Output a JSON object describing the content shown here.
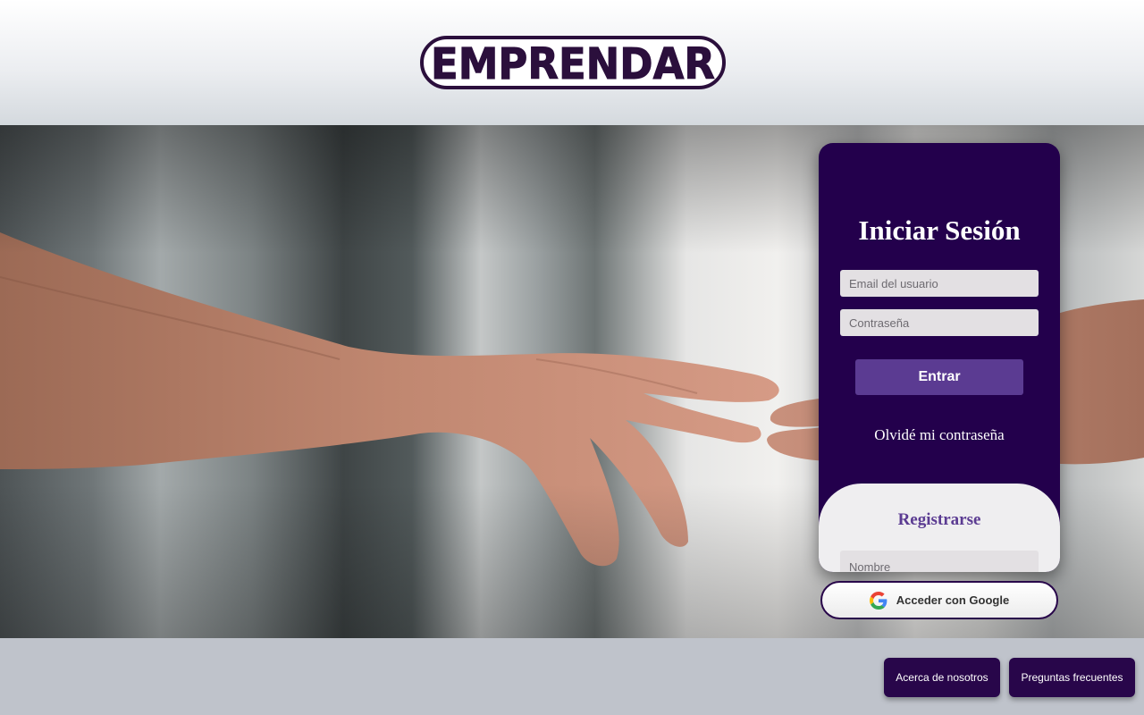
{
  "header": {
    "logo_text": "EMPRENDAR"
  },
  "login": {
    "title": "Iniciar Sesión",
    "email_placeholder": "Email del usuario",
    "password_placeholder": "Contraseña",
    "submit_label": "Entrar",
    "forgot_label": "Olvidé mi contraseña"
  },
  "register": {
    "title": "Registrarse",
    "name_placeholder": "Nombre"
  },
  "google": {
    "label": "Acceder con Google",
    "icon": "google-icon"
  },
  "footer": {
    "about_label": "Acerca de nosotros",
    "faq_label": "Preguntas frecuentes"
  },
  "colors": {
    "brand_purple": "#23004c",
    "accent_purple": "#5b3b92",
    "footer_bg": "#bfc3cb"
  }
}
